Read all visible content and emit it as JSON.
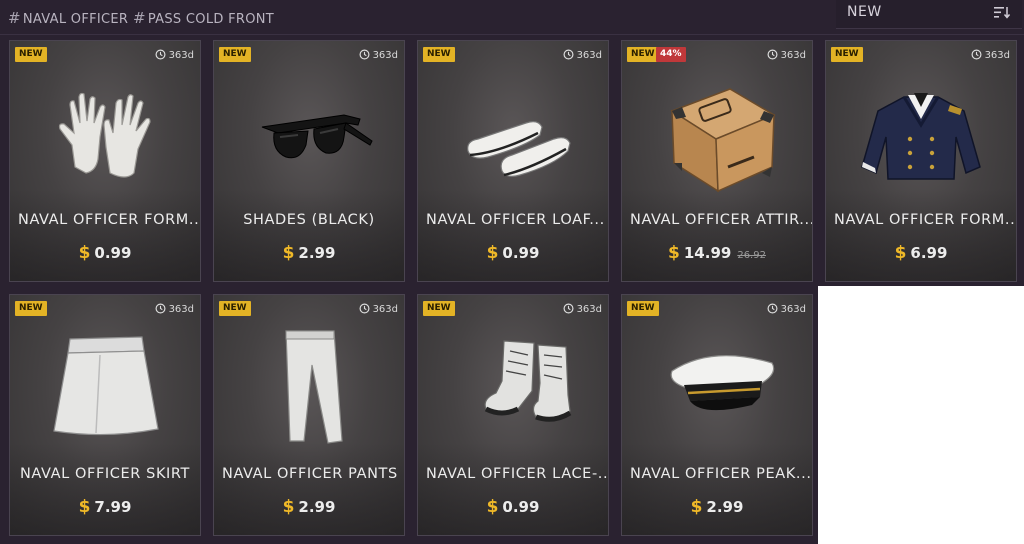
{
  "tags": [
    "NAVAL OFFICER",
    "PASS COLD FRONT"
  ],
  "sort": {
    "label": "NEW",
    "icon": "sort-icon"
  },
  "colors": {
    "badge_new": "#e3b325",
    "badge_discount": "#c0383a",
    "currency": "#f0b928"
  },
  "items": [
    {
      "name": "NAVAL OFFICER FORM...",
      "badge": "NEW",
      "timer": "363d",
      "currency": "$",
      "price": "0.99",
      "icon": "gloves-icon"
    },
    {
      "name": "SHADES (BLACK)",
      "badge": "NEW",
      "timer": "363d",
      "currency": "$",
      "price": "2.99",
      "icon": "sunglasses-icon"
    },
    {
      "name": "NAVAL OFFICER LOAF...",
      "badge": "NEW",
      "timer": "363d",
      "currency": "$",
      "price": "0.99",
      "icon": "loafers-icon"
    },
    {
      "name": "NAVAL OFFICER ATTIR...",
      "badge": "NEW",
      "discount": "44%",
      "timer": "363d",
      "currency": "$",
      "price": "14.99",
      "old_price": "26.92",
      "icon": "crate-icon"
    },
    {
      "name": "NAVAL OFFICER FORM...",
      "badge": "NEW",
      "timer": "363d",
      "currency": "$",
      "price": "6.99",
      "icon": "jacket-icon"
    },
    {
      "name": "NAVAL OFFICER SKIRT",
      "badge": "NEW",
      "timer": "363d",
      "currency": "$",
      "price": "7.99",
      "icon": "skirt-icon"
    },
    {
      "name": "NAVAL OFFICER PANTS",
      "badge": "NEW",
      "timer": "363d",
      "currency": "$",
      "price": "2.99",
      "icon": "pants-icon"
    },
    {
      "name": "NAVAL OFFICER LACE-...",
      "badge": "NEW",
      "timer": "363d",
      "currency": "$",
      "price": "0.99",
      "icon": "boots-icon"
    },
    {
      "name": "NAVAL OFFICER PEAK...",
      "badge": "NEW",
      "timer": "363d",
      "currency": "$",
      "price": "2.99",
      "icon": "peaked-cap-icon"
    }
  ]
}
